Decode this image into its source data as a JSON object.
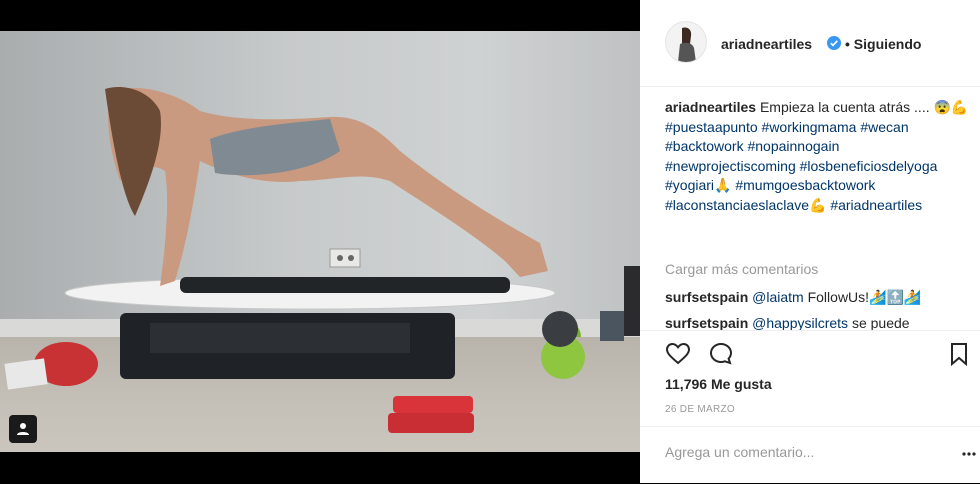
{
  "post": {
    "author": "ariadneartiles",
    "follow_dot": "•",
    "follow_status": "Siguiendo",
    "caption_user": "ariadneartiles",
    "caption_text": "Empieza la cuenta atrás .... 😨💪",
    "hashtags": [
      "#puestaapunto",
      "#workingmama",
      "#wecan",
      "#backtowork",
      "#nopainnogain",
      "#newprojectiscoming",
      "#losbeneficiosdelyoga",
      "#yogiari🙏",
      "#mumgoesbacktowork",
      "#laconstanciaeslaclave💪",
      "#ariadneartiles"
    ],
    "load_more": "Cargar más comentarios",
    "comments": [
      {
        "user": "surfsetspain",
        "mention": "@laiatm",
        "text": "FollowUs!🏄🔝🏄"
      },
      {
        "user": "surfsetspain",
        "mention": "@happysilcrets",
        "text": "se puede"
      }
    ],
    "likes": "11,796 Me gusta",
    "date": "26 DE MARZO",
    "comment_placeholder": "Agrega un comentario..."
  },
  "icons": {
    "verified": "verified-badge-icon",
    "like": "heart-icon",
    "comment": "comment-bubble-icon",
    "save": "bookmark-icon",
    "tag": "user-tag-icon",
    "more": "ellipsis-icon"
  },
  "colors": {
    "verified_blue": "#3897f0",
    "hashtag": "#003569",
    "muted": "#999999",
    "text": "#262626"
  }
}
